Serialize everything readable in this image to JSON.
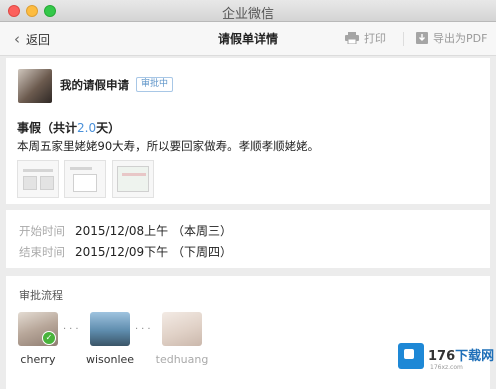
{
  "window": {
    "title": "企业微信"
  },
  "toolbar": {
    "back_label": "返回",
    "page_title": "请假单详情",
    "print_label": "打印",
    "export_label": "导出为PDF"
  },
  "request": {
    "title": "我的请假申请",
    "status": "审批中",
    "type_prefix": "事假（共计",
    "days": "2.0",
    "type_suffix": "天）",
    "reason": "本周五家里姥姥90大寿，所以要回家做寿。孝顺孝顺姥姥。",
    "attachments_count": 3
  },
  "time": {
    "start_label": "开始时间",
    "start_value": "2015/12/08上午 （本周三）",
    "end_label": "结束时间",
    "end_value": "2015/12/09下午 （下周四）"
  },
  "flow": {
    "title": "审批流程",
    "approvers": [
      {
        "name": "cherry",
        "status": "approved"
      },
      {
        "name": "wisonlee",
        "status": "pending"
      },
      {
        "name": "tedhuang",
        "status": "waiting"
      }
    ]
  },
  "watermark": {
    "brand": "176",
    "suffix": "下载网",
    "url": "176xz.com"
  },
  "colors": {
    "accent": "#4a90d9",
    "approved": "#49b33c"
  }
}
